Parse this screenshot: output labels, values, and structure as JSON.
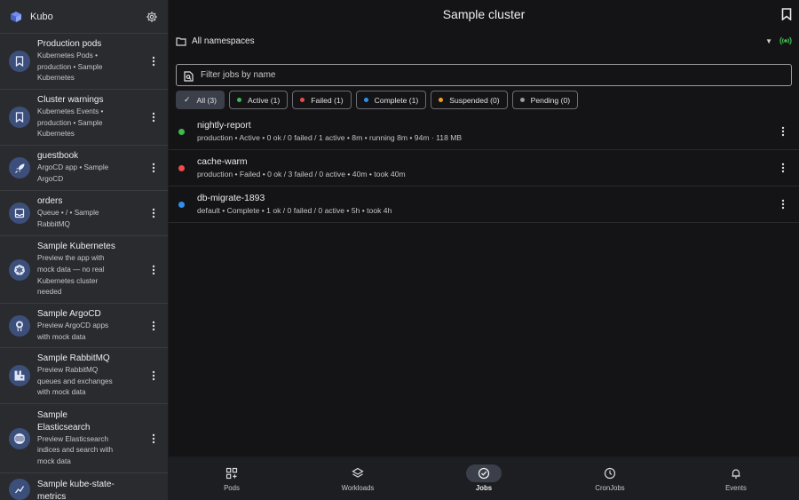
{
  "app": {
    "name": "Kubo"
  },
  "sidebar": {
    "items": [
      {
        "name": "Production pods",
        "sub": [
          "Kubernetes Pods •",
          "production • Sample",
          "Kubernetes"
        ],
        "icon": "bookmark-icon"
      },
      {
        "name": "Cluster warnings",
        "sub": [
          "Kubernetes Events •",
          "production • Sample",
          "Kubernetes"
        ],
        "icon": "bookmark-icon"
      },
      {
        "name": "guestbook",
        "sub": [
          "ArgoCD app • Sample",
          "ArgoCD"
        ],
        "icon": "rocket-icon"
      },
      {
        "name": "orders",
        "sub": [
          "Queue • / • Sample",
          "RabbitMQ"
        ],
        "icon": "inbox-icon"
      },
      {
        "name": "Sample Kubernetes",
        "sub": [
          "Preview the app with",
          "mock data — no real",
          "Kubernetes cluster",
          "needed"
        ],
        "icon": "kubernetes-icon"
      },
      {
        "name": "Sample ArgoCD",
        "sub": [
          "Preview ArgoCD apps",
          "with mock data"
        ],
        "icon": "argocd-icon"
      },
      {
        "name": "Sample RabbitMQ",
        "sub": [
          "Preview RabbitMQ",
          "queues and exchanges",
          "with mock data"
        ],
        "icon": "rabbitmq-icon"
      },
      {
        "name": "Sample Elasticsearch",
        "sub": [
          "Preview Elasticsearch",
          "indices and search with",
          "mock data"
        ],
        "icon": "elasticsearch-icon"
      },
      {
        "name": "Sample kube-state-metrics",
        "sub": [],
        "icon": "metrics-icon"
      }
    ]
  },
  "header": {
    "title": "Sample cluster"
  },
  "namespace": {
    "label": "All namespaces"
  },
  "search": {
    "placeholder": "Filter jobs by name",
    "value": ""
  },
  "filters": [
    {
      "label": "All (3)",
      "selected": true,
      "color": ""
    },
    {
      "label": "Active (1)",
      "selected": false,
      "color": "#3fb950"
    },
    {
      "label": "Failed (1)",
      "selected": false,
      "color": "#f04a4a"
    },
    {
      "label": "Complete (1)",
      "selected": false,
      "color": "#2f8ff0"
    },
    {
      "label": "Suspended (0)",
      "selected": false,
      "color": "#f0a020"
    },
    {
      "label": "Pending (0)",
      "selected": false,
      "color": "#9a9aa0"
    }
  ],
  "jobs": [
    {
      "name": "nightly-report",
      "meta": "production • Active • 0 ok / 0 failed / 1 active • 8m • running 8m • 94m · 118 MB",
      "status_color": "#3fb950"
    },
    {
      "name": "cache-warm",
      "meta": "production • Failed • 0 ok / 3 failed / 0 active • 40m • took 40m",
      "status_color": "#f04a4a"
    },
    {
      "name": "db-migrate-1893",
      "meta": "default • Complete • 1 ok / 0 failed / 0 active • 5h • took 4h",
      "status_color": "#2f8ff0"
    }
  ],
  "nav": [
    {
      "label": "Pods",
      "icon": "grid-plus-icon",
      "active": false
    },
    {
      "label": "Workloads",
      "icon": "layers-icon",
      "active": false
    },
    {
      "label": "Jobs",
      "icon": "check-circle-icon",
      "active": true
    },
    {
      "label": "CronJobs",
      "icon": "clock-icon",
      "active": false
    },
    {
      "label": "Events",
      "icon": "bell-icon",
      "active": false
    }
  ]
}
